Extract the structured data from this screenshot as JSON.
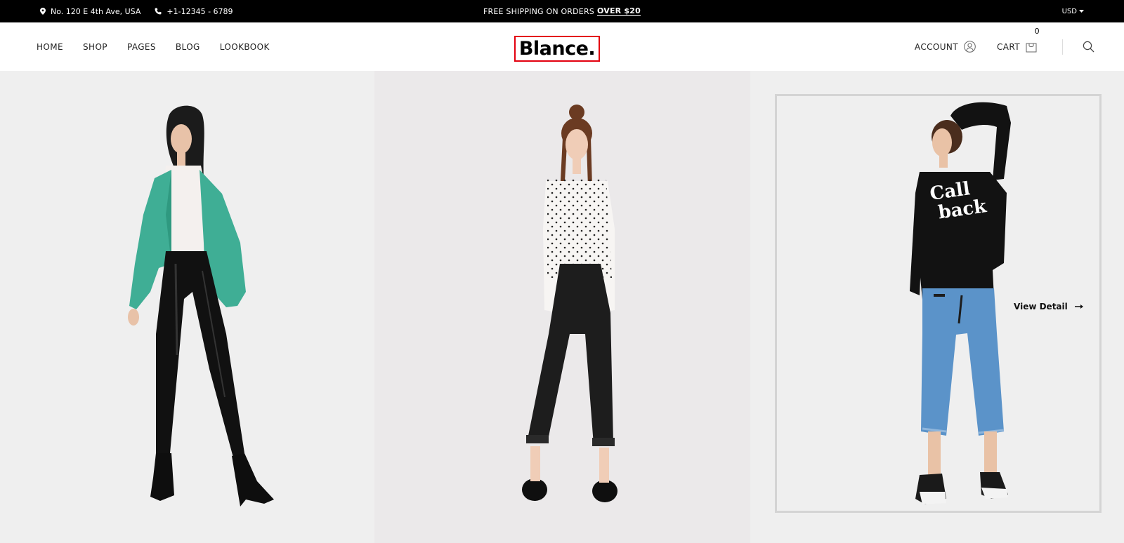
{
  "topbar": {
    "address": "No. 120 E 4th Ave, USA",
    "phone": "+1-12345 - 6789",
    "shipping_prefix": "FREE SHIPPING ON ORDERS",
    "shipping_highlight": "OVER $20",
    "currency": "USD"
  },
  "nav": {
    "items": [
      "HOME",
      "SHOP",
      "PAGES",
      "BLOG",
      "LOOKBOOK"
    ]
  },
  "logo": {
    "text": "Blance."
  },
  "header_right": {
    "account_label": "ACCOUNT",
    "cart_label": "CART",
    "cart_count": "0"
  },
  "products": [
    {
      "graphic_text": ""
    },
    {
      "graphic_text": ""
    },
    {
      "graphic_text": "Call back",
      "cta_label": "View Detail"
    }
  ],
  "colors": {
    "topbar_bg": "#000000",
    "logo_border": "#e3000f",
    "panel_bg": "#efefef",
    "jacket": "#3fae95",
    "jeans": "#5b93c9"
  },
  "icons": [
    "map-pin-icon",
    "phone-icon",
    "chevron-down-icon",
    "user-icon",
    "bag-icon",
    "search-icon",
    "arrow-right-icon"
  ]
}
